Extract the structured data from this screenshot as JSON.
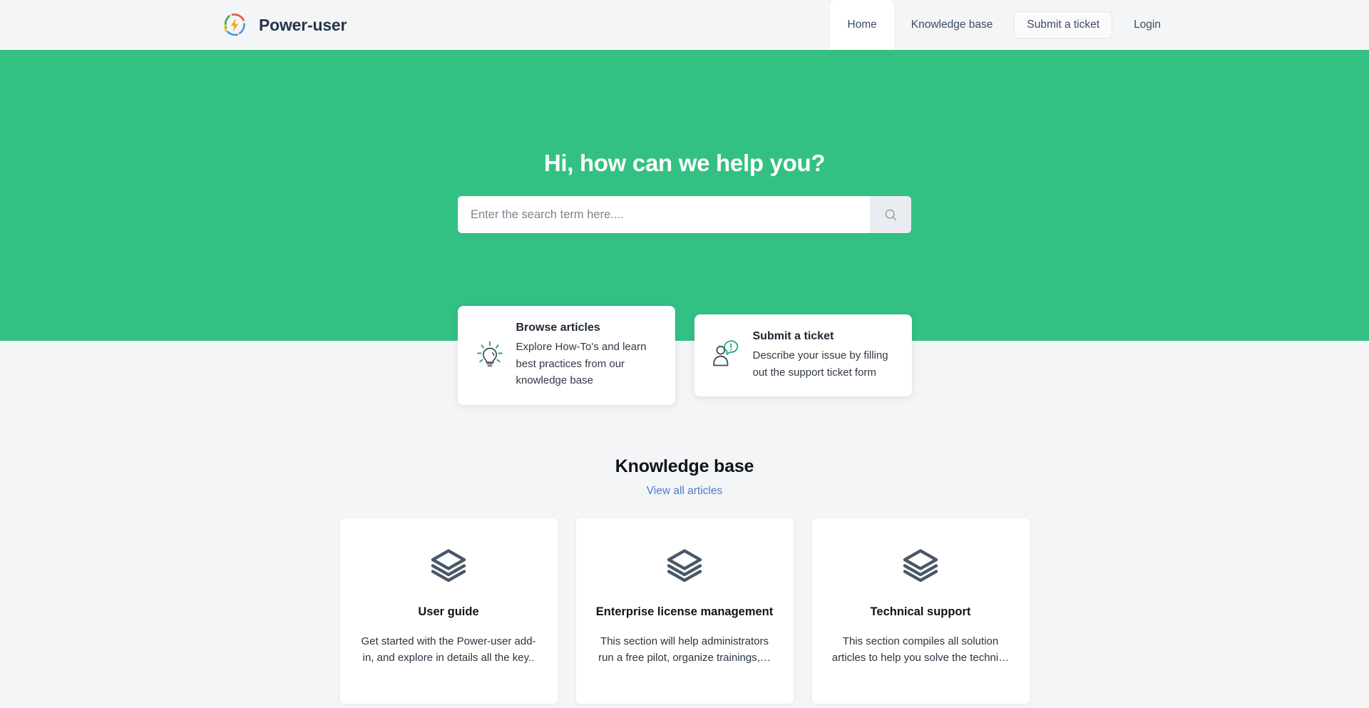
{
  "header": {
    "brand": {
      "name": "Power-user",
      "logo_icon": "power-user-lightning-logo",
      "colors": {
        "arc_green": "#34a853",
        "arc_red": "#e8563f",
        "arc_blue": "#4a90e2",
        "arc_yellow": "#f5b82e",
        "bolt": "#f5a623"
      }
    },
    "nav": [
      {
        "label": "Home",
        "active": true
      },
      {
        "label": "Knowledge base",
        "active": false
      }
    ],
    "ticket_button": {
      "label": "Submit a ticket"
    },
    "login_link": {
      "label": "Login"
    }
  },
  "hero": {
    "background_color": "#33c183",
    "title": "Hi, how can we help you?",
    "search": {
      "placeholder": "Enter the search term here....",
      "value": "",
      "button_icon": "search-icon"
    }
  },
  "action_cards": [
    {
      "icon": "lightbulb-icon",
      "title": "Browse articles",
      "description": "Explore How-To's and learn best practices from our knowledge base"
    },
    {
      "icon": "user-ticket-icon",
      "title": "Submit a ticket",
      "description": "Describe your issue by filling out the support ticket form"
    }
  ],
  "knowledge_base": {
    "title": "Knowledge base",
    "view_all_link": "View all articles",
    "link_color": "#4d7cc7",
    "cards": [
      {
        "icon": "layers-icon",
        "title": "User guide",
        "description": "Get started with the Power-user add-in, and explore in details all the key.."
      },
      {
        "icon": "layers-icon",
        "title": "Enterprise license management",
        "description": "This section will help administrators run a free pilot, organize trainings,…"
      },
      {
        "icon": "layers-icon",
        "title": "Technical support",
        "description": "This section compiles all solution articles to help you solve the techni…"
      }
    ]
  }
}
